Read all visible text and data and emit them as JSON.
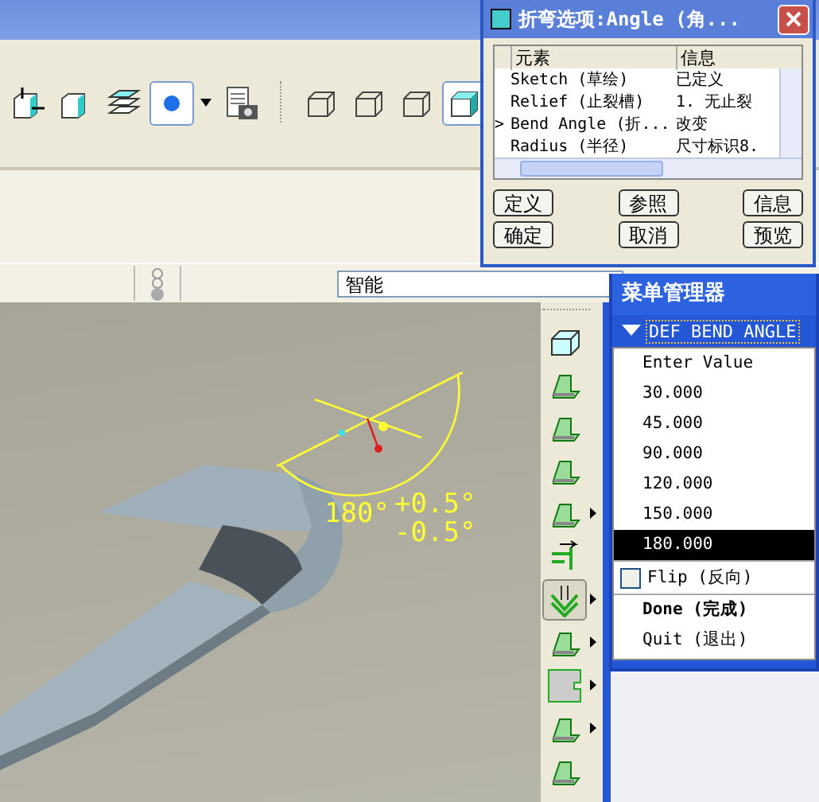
{
  "toolbar": {
    "groups": [
      [
        {
          "kind": "datum-display",
          "selected": false
        },
        {
          "kind": "text-display",
          "selected": false
        },
        {
          "kind": "layers",
          "selected": false
        },
        {
          "kind": "spin-center",
          "selected": true
        },
        {
          "kind": "dropdown",
          "selected": false
        },
        {
          "kind": "saved-view",
          "selected": false
        }
      ],
      [
        {
          "kind": "wireframe",
          "selected": false
        },
        {
          "kind": "hidden-line",
          "selected": false
        },
        {
          "kind": "no-hidden",
          "selected": false
        },
        {
          "kind": "shaded",
          "selected": true
        }
      ]
    ]
  },
  "filter": {
    "value": "智能"
  },
  "dimension": {
    "value": "180°",
    "plus": "+0.5°",
    "minus": "-0.5°"
  },
  "right_toolbar": [
    {
      "kind": "box",
      "submenu": false,
      "selected": false
    },
    {
      "kind": "flange",
      "submenu": false,
      "selected": false
    },
    {
      "kind": "wall",
      "submenu": false,
      "selected": false
    },
    {
      "kind": "wall",
      "submenu": false,
      "selected": false
    },
    {
      "kind": "plate",
      "submenu": true,
      "selected": false
    },
    {
      "kind": "arrow",
      "submenu": false,
      "selected": false
    },
    {
      "kind": "bend",
      "submenu": true,
      "selected": true
    },
    {
      "kind": "unbend",
      "submenu": true,
      "selected": false
    },
    {
      "kind": "notch",
      "submenu": true,
      "selected": false
    },
    {
      "kind": "form",
      "submenu": true,
      "selected": false
    },
    {
      "kind": "flange",
      "submenu": false,
      "selected": false
    }
  ],
  "dialog": {
    "title": "折弯选项:Angle (角...",
    "columns": [
      "元素",
      "信息"
    ],
    "rows": [
      {
        "element": "Sketch (草绘)",
        "info": "已定义"
      },
      {
        "element": "Relief (止裂槽)",
        "info": "1. 无止裂"
      },
      {
        "marker": ">",
        "element": "Bend Angle (折...",
        "info": "改变"
      },
      {
        "element": "Radius (半径)",
        "info": "尺寸标识8."
      }
    ],
    "buttons": [
      "定义",
      "参照",
      "信息",
      "确定",
      "取消",
      "预览"
    ]
  },
  "menu_manager": {
    "title": "菜单管理器",
    "section": "DEF BEND ANGLE",
    "items": [
      {
        "label": "Enter Value",
        "selected": false
      },
      {
        "label": "30.000",
        "selected": false
      },
      {
        "label": "45.000",
        "selected": false
      },
      {
        "label": "90.000",
        "selected": false
      },
      {
        "label": "120.000",
        "selected": false
      },
      {
        "label": "150.000",
        "selected": false
      },
      {
        "label": "180.000",
        "selected": true
      }
    ],
    "flip": {
      "label": "Flip (反向)",
      "checked": false
    },
    "done": "Done (完成)",
    "quit": "Quit (退出)"
  }
}
